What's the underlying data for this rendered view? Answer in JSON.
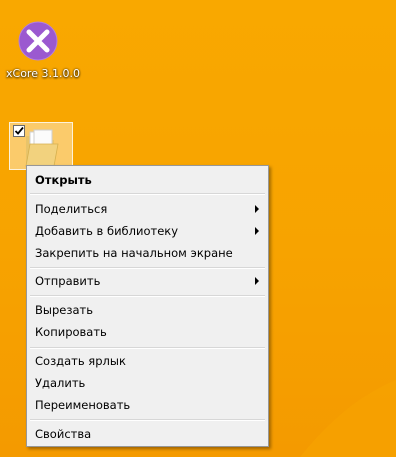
{
  "desktop": {
    "background_color": "#f7a300",
    "icons": [
      {
        "label": "xCore 3.1.0.0",
        "icon": "xcore-logo-icon",
        "color": "#9b59d0"
      },
      {
        "label": "",
        "icon": "folder-icon",
        "selected": true,
        "checked": true
      }
    ]
  },
  "context_menu": {
    "items": [
      {
        "label": "Открыть",
        "bold": true
      },
      {
        "label": "Поделиться",
        "submenu": true
      },
      {
        "label": "Добавить в библиотеку",
        "submenu": true
      },
      {
        "label": "Закрепить на начальном экране"
      },
      {
        "label": "Отправить",
        "submenu": true
      },
      {
        "label": "Вырезать"
      },
      {
        "label": "Копировать"
      },
      {
        "label": "Создать ярлык"
      },
      {
        "label": "Удалить"
      },
      {
        "label": "Переименовать"
      },
      {
        "label": "Свойства"
      }
    ]
  }
}
